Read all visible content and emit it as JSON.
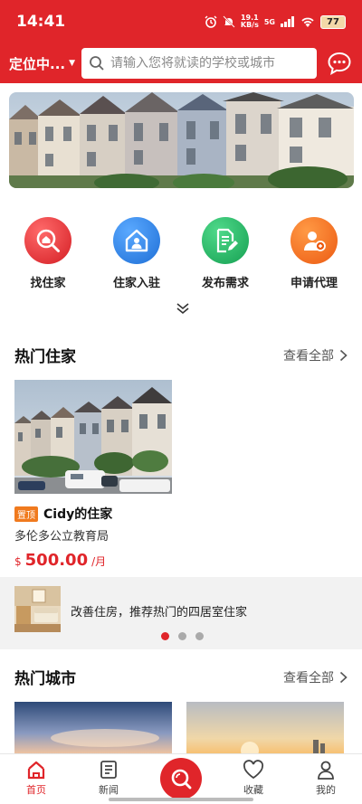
{
  "status_bar": {
    "time": "14:41",
    "net_speed_value": "19.1",
    "net_speed_unit": "KB/s",
    "network_type": "5G",
    "battery": "77"
  },
  "header": {
    "location": "定位中...",
    "search_placeholder": "请输入您将就读的学校或城市",
    "message_icon": "chat-bubble-icon"
  },
  "quick_menu": {
    "items": [
      {
        "label": "找住家",
        "icon": "house-search-icon",
        "color": "#e0252a"
      },
      {
        "label": "住家入驻",
        "icon": "house-user-icon",
        "color": "#2d7fe0"
      },
      {
        "label": "发布需求",
        "icon": "document-edit-icon",
        "color": "#1fae5e"
      },
      {
        "label": "申请代理",
        "icon": "agent-icon",
        "color": "#f06a1a"
      }
    ]
  },
  "hot_homes": {
    "title": "热门住家",
    "view_all": "查看全部",
    "cards": [
      {
        "badge": "置顶",
        "name": "Cidy的住家",
        "location": "多伦多公立教育局",
        "currency": "$",
        "price": "500.00",
        "unit": "/月"
      }
    ]
  },
  "promo": {
    "text": "改善住房，推荐热门的四居室住家",
    "carousel_total": 3,
    "carousel_active": 1
  },
  "hot_cities": {
    "title": "热门城市",
    "view_all": "查看全部"
  },
  "bottom_nav": {
    "items": [
      {
        "label": "首页",
        "icon": "home-icon",
        "active": true
      },
      {
        "label": "新闻",
        "icon": "news-icon",
        "active": false
      },
      {
        "label": "",
        "icon": "search-icon",
        "active": false
      },
      {
        "label": "收藏",
        "icon": "heart-icon",
        "active": false
      },
      {
        "label": "我的",
        "icon": "user-icon",
        "active": false
      }
    ]
  },
  "colors": {
    "brand_red": "#e0252a",
    "badge_orange": "#f07a1e"
  }
}
